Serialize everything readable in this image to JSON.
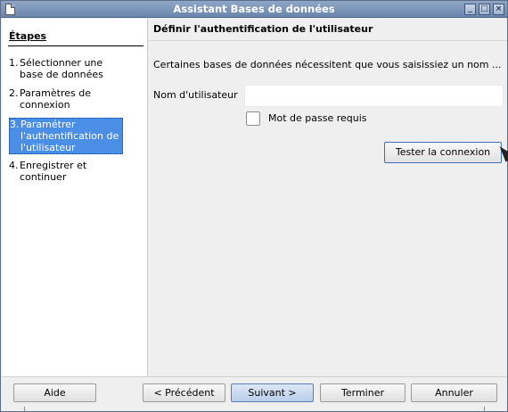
{
  "window": {
    "title": "Assistant Bases de données"
  },
  "steps": {
    "heading": "Étapes",
    "items": [
      {
        "num": "1.",
        "label": "Sélectionner une base de données"
      },
      {
        "num": "2.",
        "label": "Paramètres de connexion"
      },
      {
        "num": "3.",
        "label": "Paramétrer l'authentification de l'utilisateur"
      },
      {
        "num": "4.",
        "label": "Enregistrer et continuer"
      }
    ]
  },
  "main": {
    "title": "Définir l'authentification de l'utilisateur",
    "description": "Certaines bases de données nécessitent que vous saisissiez un nom ...",
    "username": {
      "label": "Nom d'utilisateur",
      "value": ""
    },
    "password_required": {
      "label": "Mot de passe requis",
      "checked": false
    },
    "test_button": "Tester la connexion"
  },
  "footer": {
    "help": "Aide",
    "back": "< Précédent",
    "next": "Suivant >",
    "finish": "Terminer",
    "cancel": "Annuler"
  }
}
